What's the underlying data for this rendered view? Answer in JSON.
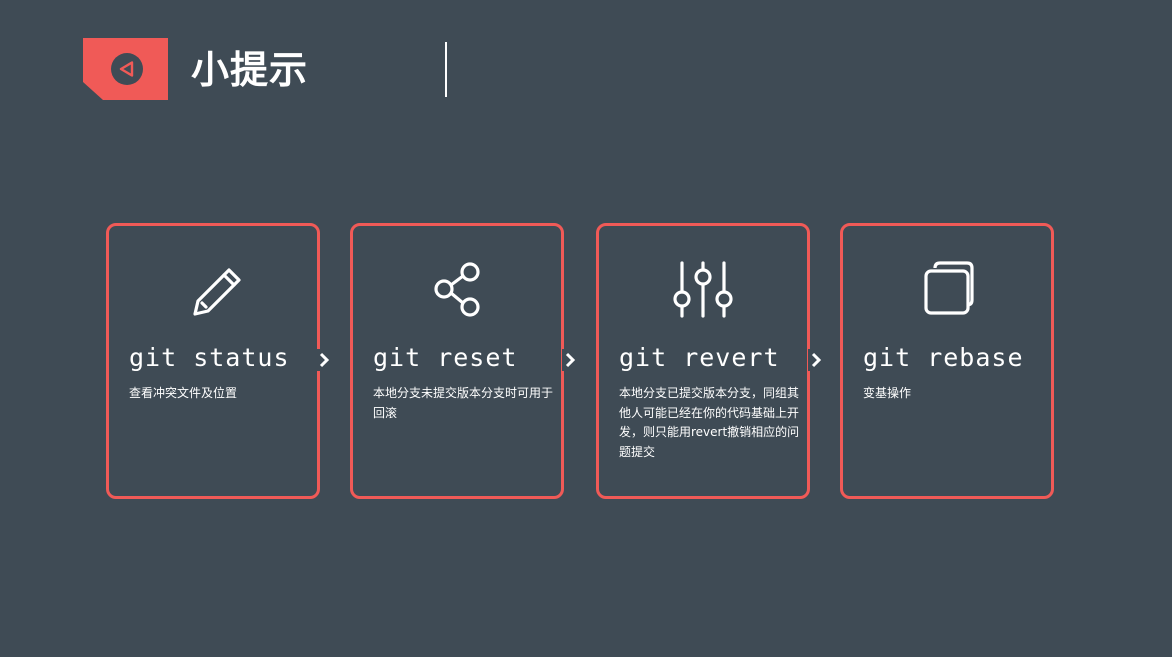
{
  "header": {
    "title": "小提示",
    "tag_icon": "play-back-icon"
  },
  "colors": {
    "background": "#3f4b55",
    "accent": "#f05a57",
    "text": "#ffffff"
  },
  "cards": [
    {
      "icon": "pencil-icon",
      "title": "git status",
      "desc": "查看冲突文件及位置"
    },
    {
      "icon": "share-icon",
      "title": "git reset",
      "desc": "本地分支未提交版本分支时可用于回滚"
    },
    {
      "icon": "sliders-icon",
      "title": "git revert",
      "desc": "本地分支已提交版本分支，同组其他人可能已经在你的代码基础上开发，则只能用revert撤销相应的问题提交"
    },
    {
      "icon": "copy-icon",
      "title": "git rebase",
      "desc": "变基操作"
    }
  ]
}
